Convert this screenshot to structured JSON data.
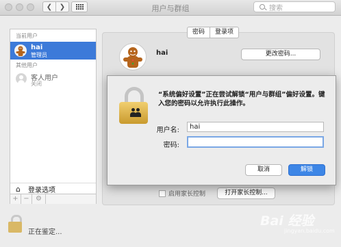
{
  "window": {
    "title": "用户与群组"
  },
  "toolbar": {
    "back_icon": "chevron-left-icon",
    "forward_icon": "chevron-right-icon",
    "grid_icon": "show-all-icon",
    "search_placeholder": "搜索"
  },
  "sidebar": {
    "current_users_label": "当前用户",
    "current_user": {
      "name": "hai",
      "role": "管理员"
    },
    "other_users_label": "其他用户",
    "guest": {
      "name": "客人用户",
      "status": "关闭"
    },
    "login_options_label": "登录选项",
    "add_label": "+",
    "remove_label": "−",
    "gear_label": "⚙"
  },
  "panel": {
    "tabs": [
      "密码",
      "登录项"
    ],
    "user_name": "hai",
    "change_password_label": "更改密码...",
    "parental_checkbox_label": "启用家长控制",
    "open_parental_label": "打开家长控制..."
  },
  "footer": {
    "status_text": "正在鉴定..."
  },
  "dialog": {
    "message": "“系统偏好设置”正在尝试解锁“用户与群组”偏好设置。键入您的密码以允许执行此操作。",
    "username_label": "用户名:",
    "username_value": "hai",
    "password_label": "密码:",
    "password_value": "",
    "cancel_label": "取消",
    "unlock_label": "解锁"
  },
  "watermark": {
    "text": "Bai 经验",
    "sub": "jingyan.baidu.com"
  },
  "colors": {
    "accent": "#3c7ad9",
    "primary_button": "#3d86e6",
    "lock_gold": "#d9b866"
  }
}
